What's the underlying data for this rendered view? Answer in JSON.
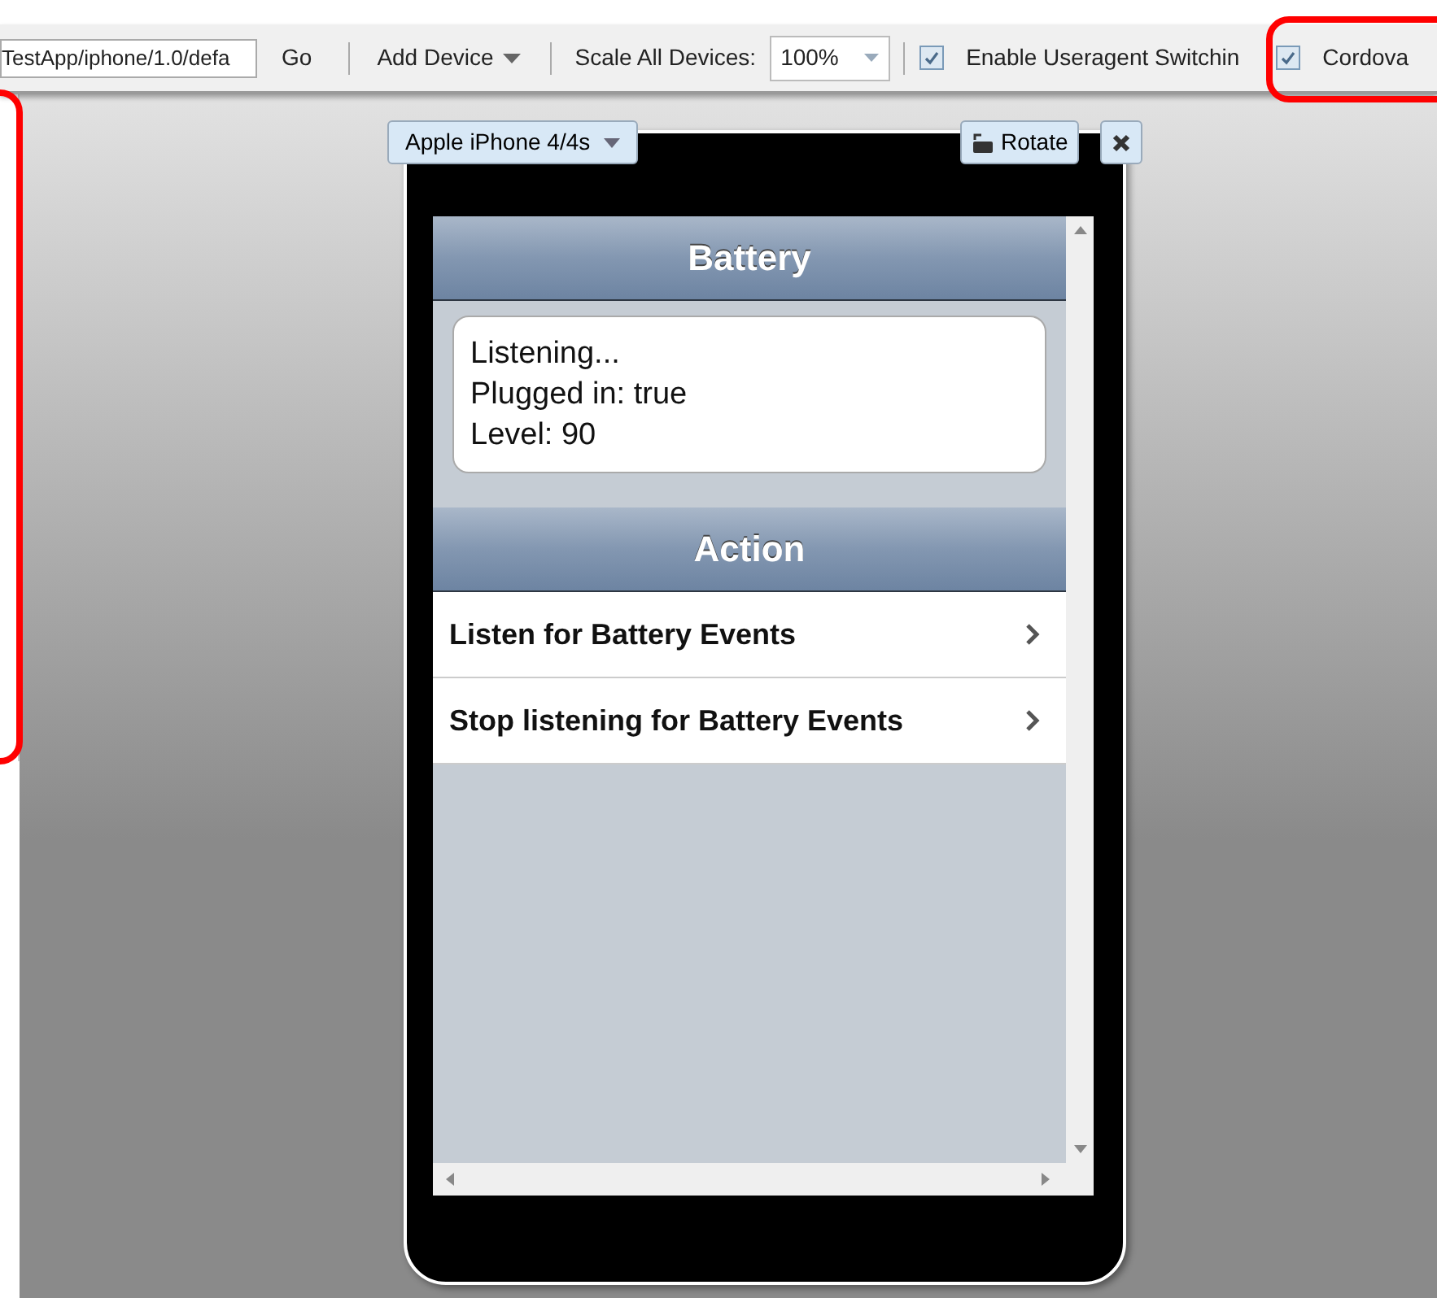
{
  "toolbar": {
    "url_field": {
      "value": "TestApp/iphone/1.0/defa"
    },
    "go_button": "Go",
    "add_device_button": "Add Device",
    "scale_label": "Scale All Devices:",
    "scale_select": {
      "value": "100%"
    },
    "options": [
      {
        "label": "Enable Useragent Switchin",
        "checked": true
      },
      {
        "label": "Cordova",
        "checked": true
      }
    ]
  },
  "device": {
    "name": "Apple iPhone 4/4s",
    "rotate_button": "Rotate",
    "app": {
      "battery_header": "Battery",
      "status_lines": [
        "Listening...",
        "Plugged in: true",
        "Level: 90"
      ],
      "action_header": "Action",
      "actions": [
        "Listen for Battery Events",
        "Stop listening for Battery Events"
      ]
    }
  }
}
